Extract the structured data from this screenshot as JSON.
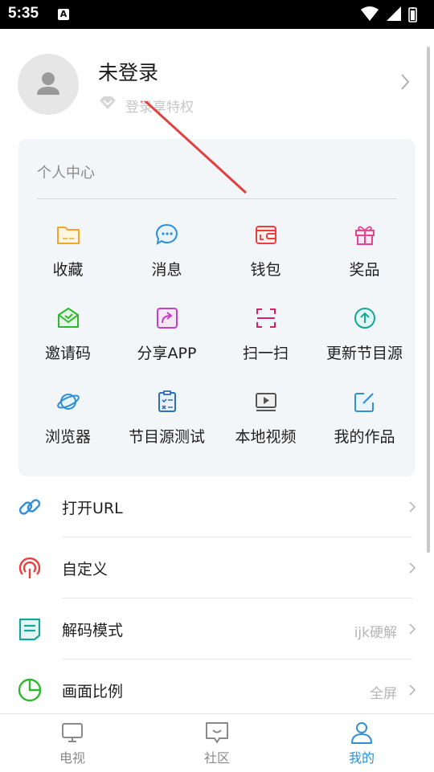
{
  "status_bar": {
    "time": "5:35",
    "notification_icon": "A"
  },
  "profile": {
    "login_title": "未登录",
    "privilege_text": "登录享特权"
  },
  "personal_center": {
    "title": "个人中心",
    "items": [
      {
        "label": "收藏",
        "icon": "folder-icon",
        "color": "#f5a623"
      },
      {
        "label": "消息",
        "icon": "chat-icon",
        "color": "#2f8fd8"
      },
      {
        "label": "钱包",
        "icon": "wallet-icon",
        "color": "#e8403c"
      },
      {
        "label": "奖品",
        "icon": "gift-icon",
        "color": "#e84393"
      },
      {
        "label": "邀请码",
        "icon": "invite-envelope-icon",
        "color": "#2eb82e"
      },
      {
        "label": "分享APP",
        "icon": "share-icon",
        "color": "#c040c8"
      },
      {
        "label": "扫一扫",
        "icon": "scan-icon",
        "color": "#d6206a"
      },
      {
        "label": "更新节目源",
        "icon": "upload-icon",
        "color": "#16a59a"
      },
      {
        "label": "浏览器",
        "icon": "planet-icon",
        "color": "#2f8fd8"
      },
      {
        "label": "节目源测试",
        "icon": "clipboard-check-icon",
        "color": "#2f6fb8"
      },
      {
        "label": "本地视频",
        "icon": "video-player-icon",
        "color": "#555555"
      },
      {
        "label": "我的作品",
        "icon": "edit-icon",
        "color": "#2f8fd8"
      }
    ]
  },
  "menu": [
    {
      "label": "打开URL",
      "value": "",
      "icon": "link-icon",
      "color": "#2f8fd8"
    },
    {
      "label": "自定义",
      "value": "",
      "icon": "custom-signal-icon",
      "color": "#e8403c"
    },
    {
      "label": "解码模式",
      "value": "ijk硬解",
      "icon": "decode-icon",
      "color": "#16a59a"
    },
    {
      "label": "画面比例",
      "value": "全屏",
      "icon": "pie-icon",
      "color": "#2eb82e"
    }
  ],
  "bottom_nav": [
    {
      "label": "电视",
      "icon": "tv-icon",
      "active": false
    },
    {
      "label": "社区",
      "icon": "community-icon",
      "active": false
    },
    {
      "label": "我的",
      "icon": "person-icon",
      "active": true
    }
  ],
  "colors": {
    "accent": "#2f8fd8",
    "annotation_arrow": "#e04040"
  }
}
